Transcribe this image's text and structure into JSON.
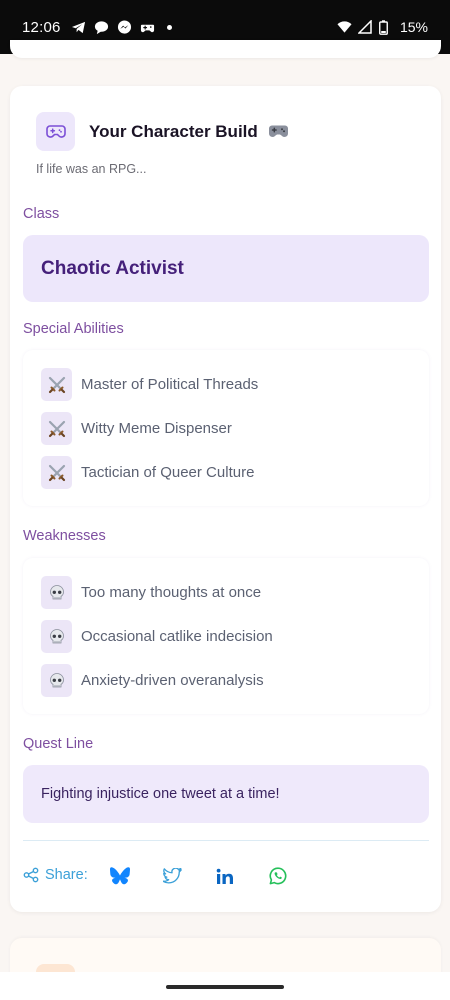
{
  "status_bar": {
    "time": "12:06",
    "battery": "15%",
    "notification_icons": [
      "telegram-icon",
      "chat-bubble-icon",
      "messenger-icon",
      "game-controller-icon"
    ]
  },
  "card": {
    "title": "Your Character Build",
    "title_emoji": "game-controller-icon",
    "subtitle": "If life was an RPG...",
    "class_label": "Class",
    "class_value": "Chaotic Activist",
    "abilities_label": "Special Abilities",
    "abilities": [
      {
        "icon": "crossed-swords-icon",
        "text": "Master of Political Threads"
      },
      {
        "icon": "crossed-swords-icon",
        "text": "Witty Meme Dispenser"
      },
      {
        "icon": "crossed-swords-icon",
        "text": "Tactician of Queer Culture"
      }
    ],
    "weaknesses_label": "Weaknesses",
    "weaknesses": [
      {
        "icon": "skull-icon",
        "text": "Too many thoughts at once"
      },
      {
        "icon": "skull-icon",
        "text": "Occasional catlike indecision"
      },
      {
        "icon": "skull-icon",
        "text": "Anxiety-driven overanalysis"
      }
    ],
    "quest_label": "Quest Line",
    "quest_text": "Fighting injustice one tweet at a time!",
    "share_label": "Share:",
    "share_targets": [
      "bluesky-icon",
      "twitter-icon",
      "linkedin-icon",
      "whatsapp-icon"
    ]
  },
  "colors": {
    "accent_purple": "#7e4fa0",
    "class_bg": "#ede7fb",
    "share_blue": "#3ba0d8",
    "whatsapp_green": "#25c05a"
  }
}
